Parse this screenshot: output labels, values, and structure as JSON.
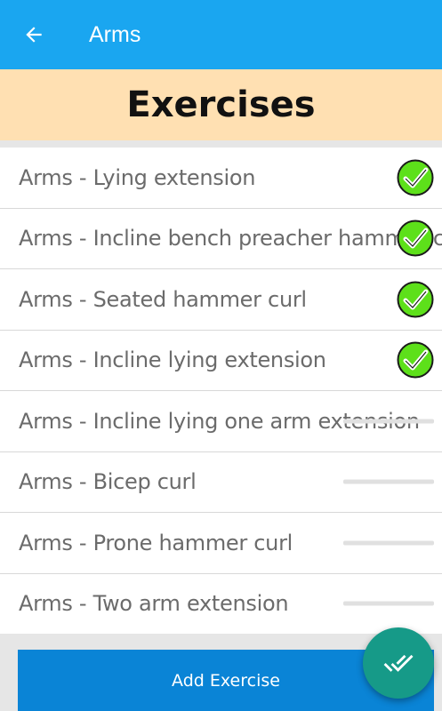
{
  "app_bar": {
    "title": "Arms",
    "back_icon": "arrow-left-icon",
    "background": "#1aa6f0"
  },
  "banner": {
    "title": "Exercises",
    "background": "#ffe0b2"
  },
  "exercises": [
    {
      "label": "Arms - Lying extension",
      "status": "done"
    },
    {
      "label": "Arms - Incline bench preacher hammer curl",
      "status": "done"
    },
    {
      "label": "Arms - Seated hammer curl",
      "status": "done"
    },
    {
      "label": "Arms - Incline lying extension",
      "status": "done"
    },
    {
      "label": "Arms - Incline lying one arm extension",
      "status": "pending"
    },
    {
      "label": "Arms - Bicep curl",
      "status": "pending"
    },
    {
      "label": "Arms - Prone hammer curl",
      "status": "pending"
    },
    {
      "label": "Arms - Two arm extension",
      "status": "pending"
    }
  ],
  "add_button": {
    "label": "Add Exercise",
    "background": "#0a84d6"
  },
  "fab": {
    "icon": "double-check-icon",
    "background": "#169a88"
  },
  "colors": {
    "check_green": "#5de01a",
    "pending_dash": "#e0e0e0"
  }
}
